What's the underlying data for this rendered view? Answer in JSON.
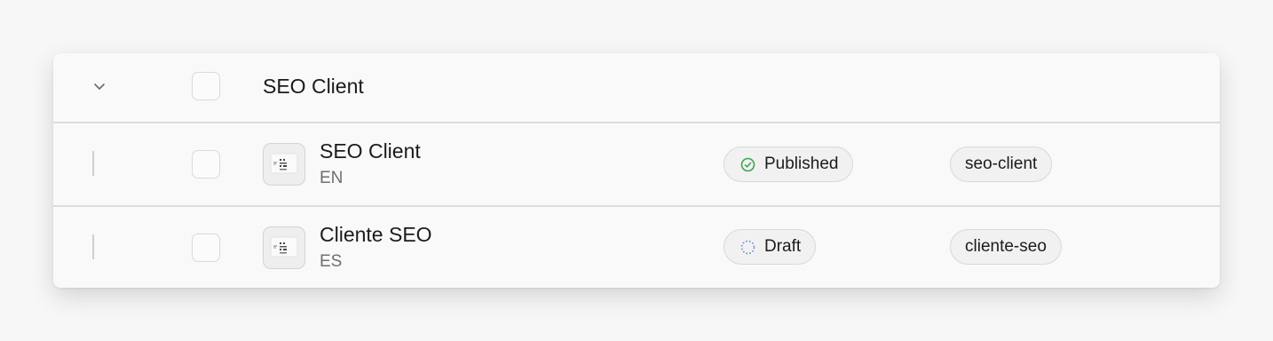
{
  "group": {
    "title": "SEO Client"
  },
  "rows": [
    {
      "title": "SEO Client",
      "locale": "EN",
      "status": "Published",
      "slug": "seo-client"
    },
    {
      "title": "Cliente SEO",
      "locale": "ES",
      "status": "Draft",
      "slug": "cliente-seo"
    }
  ],
  "colors": {
    "published": "#3ea44f",
    "draft": "#5b7fd6",
    "border": "#d8d8d8",
    "text": "#1b1b1b",
    "muted": "#6f6f6f"
  },
  "icons": {
    "collapse": "chevron-down-icon",
    "published": "check-circle-icon",
    "draft": "dashed-circle-icon",
    "thumbnail": "document-thumbnail-icon"
  }
}
